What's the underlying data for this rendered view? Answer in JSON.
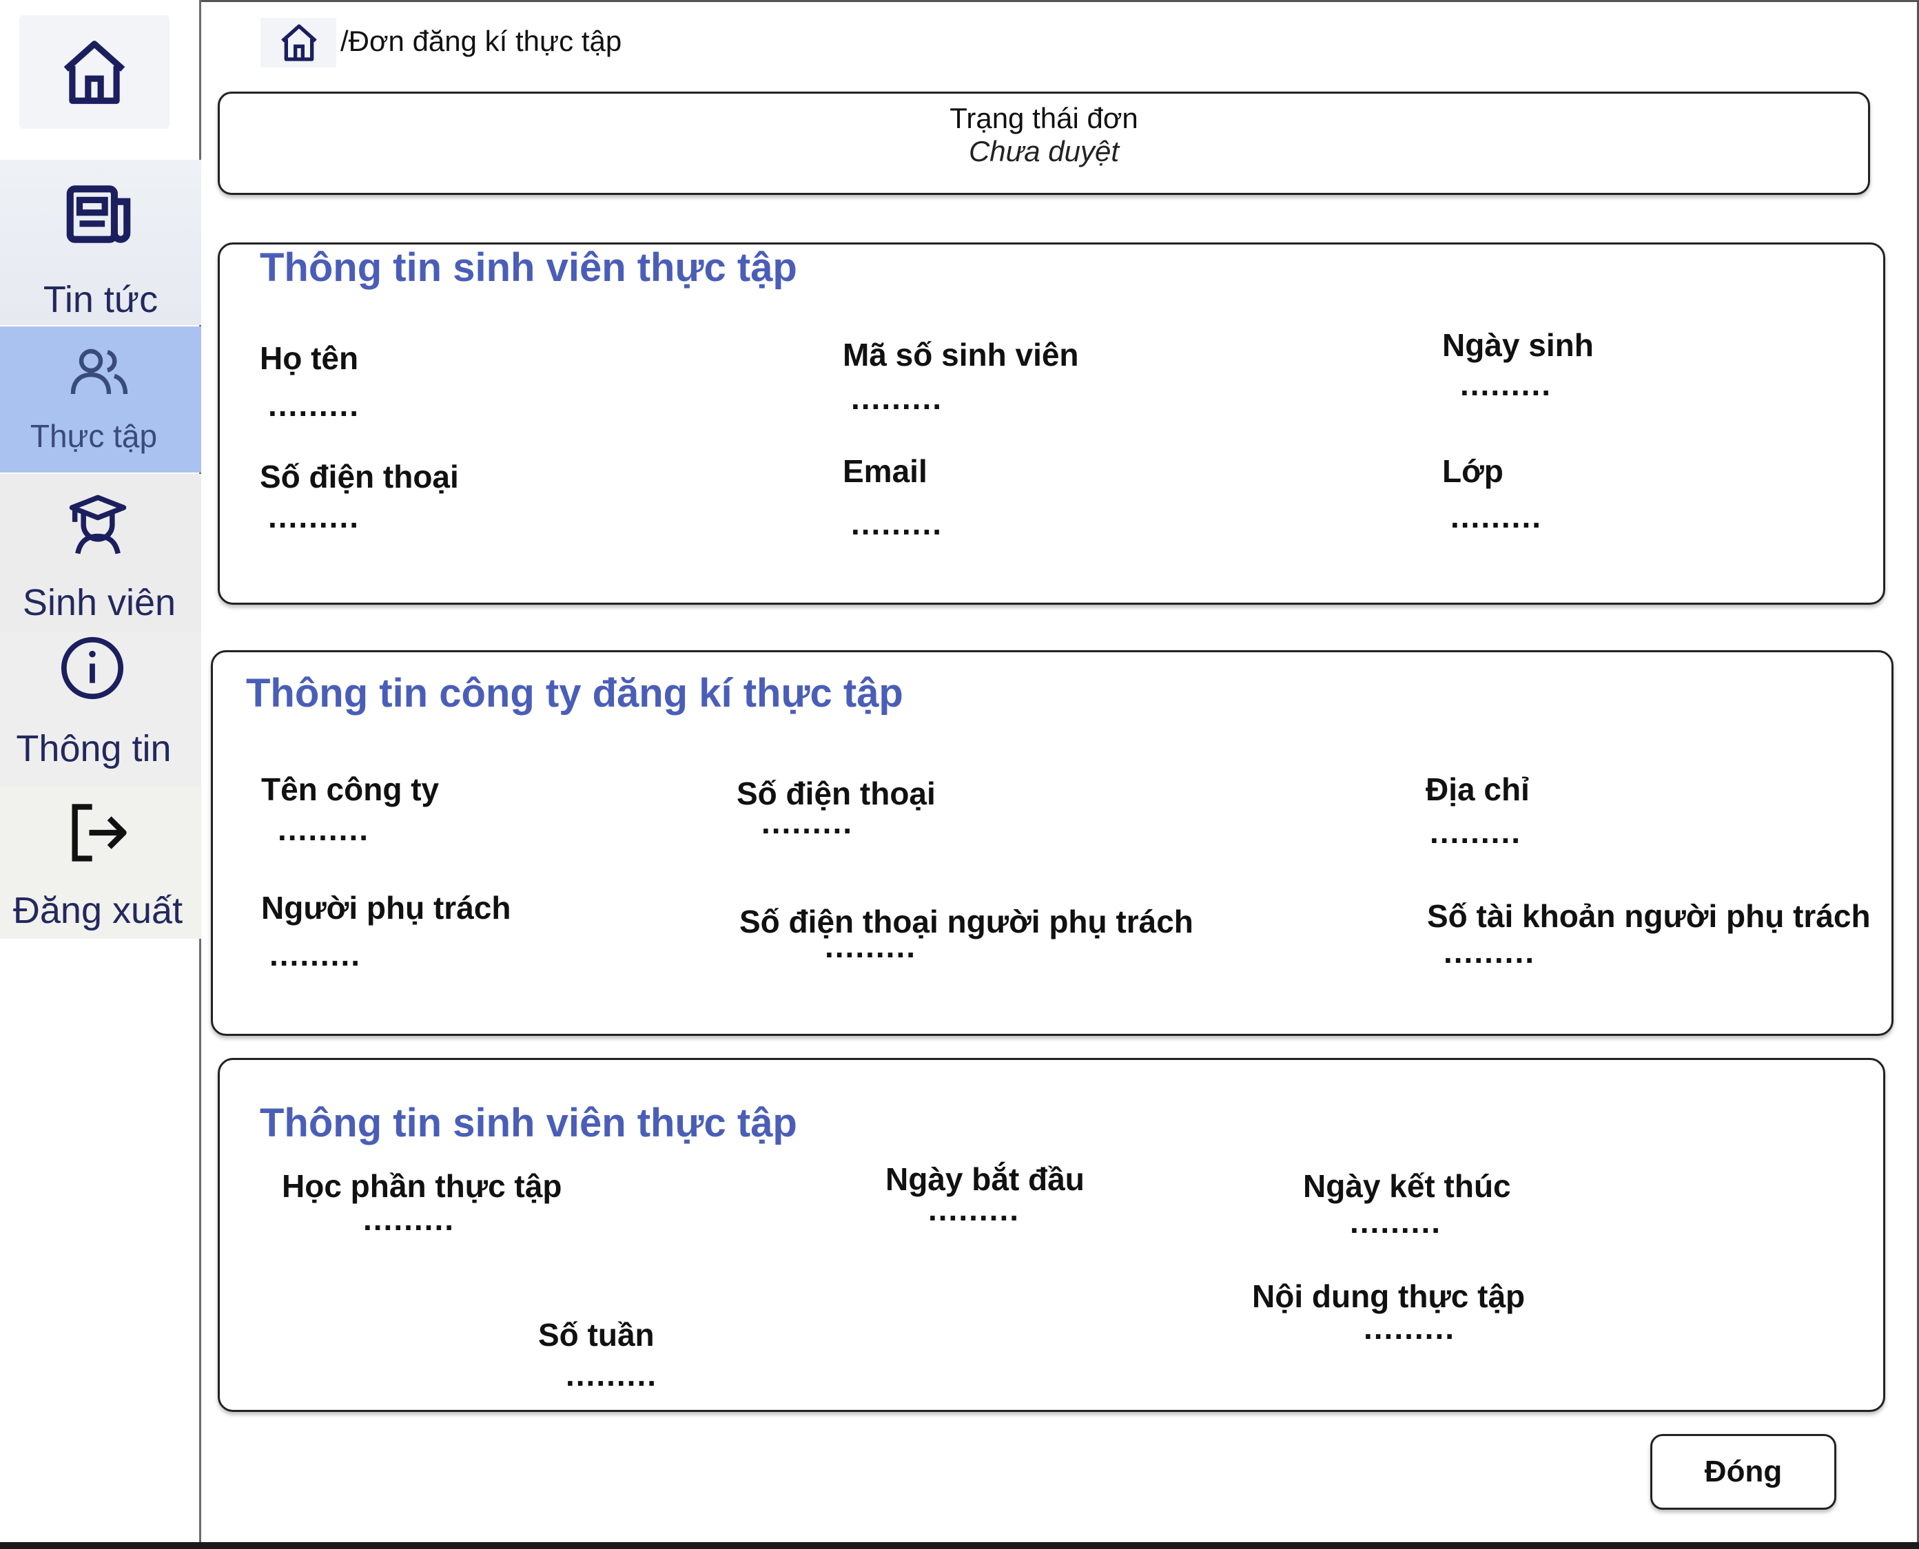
{
  "sidebar": {
    "home_icon": "home-icon",
    "items": [
      {
        "label": "Tin tức",
        "icon": "newspaper-icon"
      },
      {
        "label": "Thực tập",
        "icon": "users-icon"
      },
      {
        "label": "Sinh viên",
        "icon": "student-icon"
      },
      {
        "label": "Thông tin",
        "icon": "info-icon"
      },
      {
        "label": "Đăng xuất",
        "icon": "logout-icon"
      }
    ],
    "active_color": "#a9c2f0",
    "icon_color": "#1b1f5e"
  },
  "breadcrumb": {
    "home_icon": "home-icon",
    "path": "/Đơn đăng kí thực tập"
  },
  "status": {
    "title": "Trạng thái đơn",
    "value": "Chưa duyệt"
  },
  "student_section": {
    "title": "Thông tin sinh viên thực tập",
    "fields": [
      {
        "label": "Họ tên",
        "value": "........."
      },
      {
        "label": "Mã số sinh viên",
        "value": "........."
      },
      {
        "label": "Ngày sinh",
        "value": "........."
      },
      {
        "label": "Số điện thoại",
        "value": "........."
      },
      {
        "label": "Email",
        "value": "........."
      },
      {
        "label": "Lớp",
        "value": "........."
      }
    ]
  },
  "company_section": {
    "title": "Thông tin công ty đăng kí thực tập",
    "fields": [
      {
        "label": "Tên công ty",
        "value": "........."
      },
      {
        "label": "Số điện thoại",
        "value": "........."
      },
      {
        "label": "Địa chỉ",
        "value": "........."
      },
      {
        "label": "Người phụ trách",
        "value": "........."
      },
      {
        "label": "Số điện thoại người phụ trách",
        "value": "........."
      },
      {
        "label": "Số tài khoản người phụ trách",
        "value": "........."
      }
    ]
  },
  "internship_section": {
    "title": "Thông tin sinh viên thực tập",
    "fields": [
      {
        "label": "Học phần thực tập",
        "value": "........."
      },
      {
        "label": "Ngày bắt đầu",
        "value": "........."
      },
      {
        "label": "Ngày kết thúc",
        "value": "........."
      },
      {
        "label": "Nội dung thực tập",
        "value": "........."
      },
      {
        "label": "Số tuần",
        "value": "........."
      }
    ]
  },
  "actions": {
    "close_label": "Đóng"
  },
  "colors": {
    "title_blue": "#4a5eb8",
    "border": "#222222"
  }
}
